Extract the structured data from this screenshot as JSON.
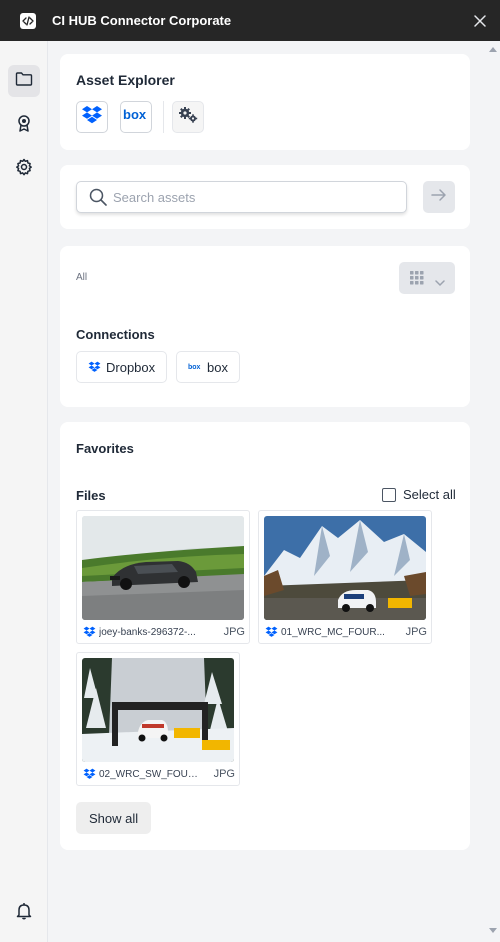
{
  "window": {
    "title": "CI HUB Connector Corporate"
  },
  "sidebar": {
    "items": [
      {
        "icon": "folder-icon"
      },
      {
        "icon": "award-icon"
      },
      {
        "icon": "gear-icon"
      }
    ],
    "bottom_icon": "bell-icon"
  },
  "asset_explorer": {
    "title": "Asset Explorer",
    "providers": [
      {
        "name": "Dropbox",
        "icon": "dropbox-icon"
      },
      {
        "name": "box",
        "icon": "box-icon"
      }
    ],
    "settings_icon": "gears-icon"
  },
  "search": {
    "placeholder": "Search assets",
    "value": ""
  },
  "filter": {
    "scope_label": "All"
  },
  "connections": {
    "title": "Connections",
    "items": [
      {
        "label": "Dropbox",
        "icon": "dropbox-icon"
      },
      {
        "label": "box",
        "icon": "box-icon"
      }
    ]
  },
  "favorites": {
    "title": "Favorites",
    "files_title": "Files",
    "select_all_label": "Select all",
    "files": [
      {
        "name": "joey-banks-296372-...",
        "type": "JPG",
        "source_icon": "dropbox-icon"
      },
      {
        "name": "01_WRC_MC_FOUR...",
        "type": "JPG",
        "source_icon": "dropbox-icon"
      },
      {
        "name": "02_WRC_SW_FOUR...",
        "type": "JPG",
        "source_icon": "dropbox-icon"
      }
    ],
    "show_all_label": "Show all"
  },
  "colors": {
    "titlebar": "#262626",
    "dropbox_blue": "#0061FE",
    "box_blue": "#0061D5",
    "background": "#f3f4f6"
  }
}
